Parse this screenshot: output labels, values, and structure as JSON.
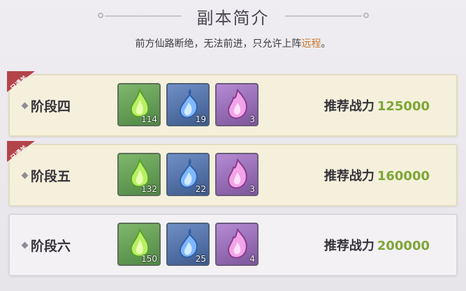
{
  "header": {
    "title": "副本简介",
    "desc_prefix": "前方仙路断绝，无法前进，只允许上阵",
    "desc_highlight": "远程",
    "desc_suffix": "。"
  },
  "colors": {
    "highlight": "#c8772a",
    "power_value": "#7ea536",
    "badge": "#b3444a"
  },
  "stages": [
    {
      "name": "阶段四",
      "cleared": true,
      "badge": "已通关",
      "power_label": "推荐战力",
      "power_value": "125000",
      "items": [
        {
          "icon": "green-flame-icon",
          "count": "114"
        },
        {
          "icon": "blue-flame-icon",
          "count": "19"
        },
        {
          "icon": "purple-flame-icon",
          "count": "3"
        }
      ]
    },
    {
      "name": "阶段五",
      "cleared": true,
      "badge": "已通关",
      "power_label": "推荐战力",
      "power_value": "160000",
      "items": [
        {
          "icon": "green-flame-icon",
          "count": "132"
        },
        {
          "icon": "blue-flame-icon",
          "count": "22"
        },
        {
          "icon": "purple-flame-icon",
          "count": "3"
        }
      ]
    },
    {
      "name": "阶段六",
      "cleared": false,
      "power_label": "推荐战力",
      "power_value": "200000",
      "items": [
        {
          "icon": "green-flame-icon",
          "count": "150"
        },
        {
          "icon": "blue-flame-icon",
          "count": "25"
        },
        {
          "icon": "purple-flame-icon",
          "count": "4"
        }
      ]
    }
  ]
}
